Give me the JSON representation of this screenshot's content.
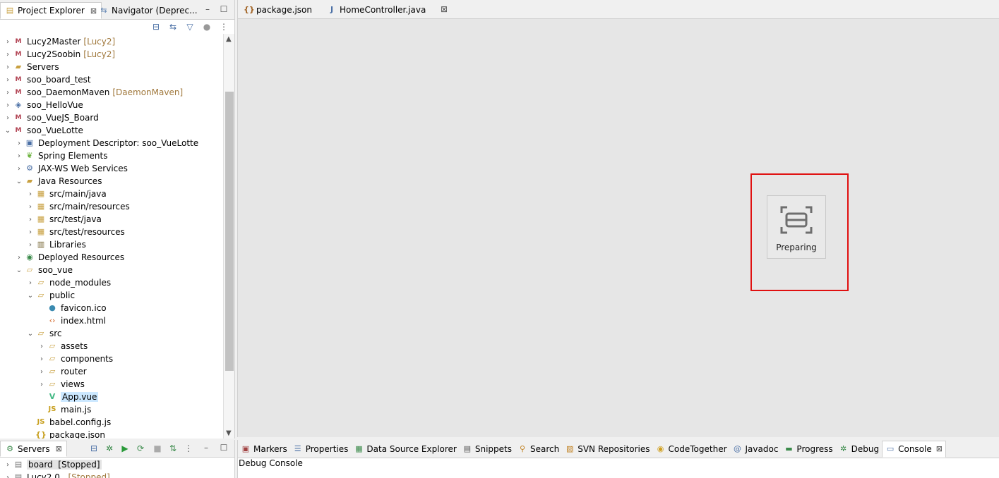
{
  "left_view": {
    "tabs": [
      {
        "label": "Project Explorer",
        "close": "⊠"
      },
      {
        "label": "Navigator (Deprec..."
      }
    ],
    "minimize": "–",
    "maximize": "☐"
  },
  "tree": [
    {
      "label": "Lucy2Master",
      "suffix": "[Lucy2]"
    },
    {
      "label": "Lucy2Soobin",
      "suffix": "[Lucy2]"
    },
    {
      "label": "Servers"
    },
    {
      "label": "soo_board_test"
    },
    {
      "label": "soo_DaemonMaven",
      "suffix": "[DaemonMaven]"
    },
    {
      "label": "soo_HelloVue"
    },
    {
      "label": "soo_VueJS_Board"
    },
    {
      "label": "soo_VueLotte"
    },
    {
      "label": "Deployment Descriptor: soo_VueLotte"
    },
    {
      "label": "Spring Elements"
    },
    {
      "label": "JAX-WS Web Services"
    },
    {
      "label": "Java Resources"
    },
    {
      "label": "src/main/java"
    },
    {
      "label": "src/main/resources"
    },
    {
      "label": "src/test/java"
    },
    {
      "label": "src/test/resources"
    },
    {
      "label": "Libraries"
    },
    {
      "label": "Deployed Resources"
    },
    {
      "label": "soo_vue"
    },
    {
      "label": "node_modules"
    },
    {
      "label": "public"
    },
    {
      "label": "favicon.ico"
    },
    {
      "label": "index.html"
    },
    {
      "label": "src"
    },
    {
      "label": "assets"
    },
    {
      "label": "components"
    },
    {
      "label": "router"
    },
    {
      "label": "views"
    },
    {
      "label": "App.vue"
    },
    {
      "label": "main.js"
    },
    {
      "label": "babel.config.js"
    },
    {
      "label": "package.json"
    }
  ],
  "editor": {
    "tabs": [
      {
        "label": "package.json"
      },
      {
        "label": "HomeController.java"
      }
    ],
    "close": "⊠",
    "preparing_label": "Preparing"
  },
  "servers_view": {
    "tab_label": "Servers",
    "close": "⊠",
    "rows": [
      {
        "label": "board",
        "status": "[Stopped]"
      },
      {
        "label": "Lucy2.0",
        "status": "[Stopped]"
      }
    ]
  },
  "bottom_view": {
    "tabs": [
      {
        "label": "Markers"
      },
      {
        "label": "Properties"
      },
      {
        "label": "Data Source Explorer"
      },
      {
        "label": "Snippets"
      },
      {
        "label": "Search"
      },
      {
        "label": "SVN Repositories"
      },
      {
        "label": "CodeTogether"
      },
      {
        "label": "Javadoc"
      },
      {
        "label": "Progress"
      },
      {
        "label": "Debug"
      },
      {
        "label": "Console"
      }
    ],
    "close": "⊠",
    "console_title": "Debug Console"
  },
  "colors": {
    "highlight": "#e01010",
    "selection": "#cce8ff"
  }
}
